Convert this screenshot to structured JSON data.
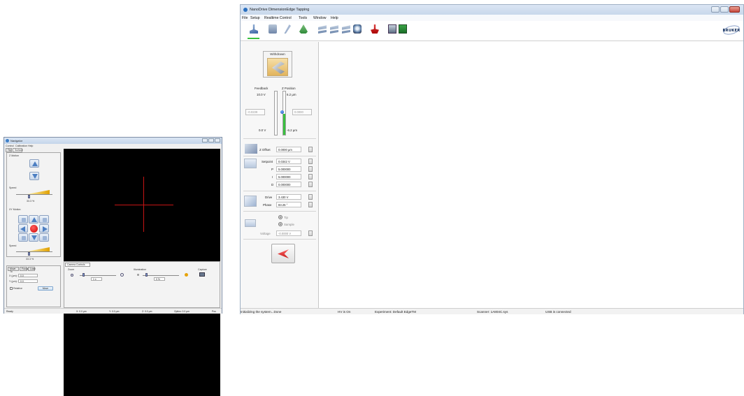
{
  "navigator": {
    "title": "Navigator",
    "menu": [
      "Control",
      "Calibration",
      "Help"
    ],
    "tabs": [
      "Tip",
      "Surface"
    ],
    "z_motion_label": "Z Motion",
    "speed_label": "Speed",
    "z_speed_value": "33.3 %",
    "xy_motion_label": "XY Motion",
    "xy_speed_value": "33.3 %",
    "bottom_tabs": [
      "Move To",
      "Focus",
      "Load"
    ],
    "x_label": "X (µm):",
    "x_value": "0.0",
    "y_label": "Y (µm):",
    "y_value": "0.0",
    "relative_label": "Relative",
    "move_label": "Move",
    "camera_controls_label": "Camera Controls",
    "zoom_label": "Zoom",
    "zoom_value": "1 x",
    "illumination_label": "Illumination",
    "illumination_value": "0 %",
    "capture_label": "Capture",
    "status": [
      "Ready",
      "X: 0.0 µm",
      "Y: 0.0 µm",
      "Z: 0.0 µm",
      "Optics: 0.0 µm",
      "Pos"
    ]
  },
  "nanodrive": {
    "title": "NanoDrive DimensionEdge Tapping",
    "menu": [
      "File",
      "Setup",
      "Realtime Control",
      "Tools",
      "Window",
      "Help"
    ],
    "logo_text": "BRUKER",
    "withdrawn_label": "Withdrawn",
    "feedback_label": "Feedback",
    "z_position_label": "Z Position",
    "feedback_max": "10.0 V",
    "z_pos_max": "6.2 µm",
    "feedback_readout": "-0.0239",
    "z_readout": "0.0000",
    "feedback_min": "0.0 V",
    "z_pos_min": "-6.2 µm",
    "z_offset_label": "Z Offset",
    "z_offset_value": "0.0000 µm",
    "setpoint_label": "Setpoint",
    "setpoint_value": "0.0342 V",
    "p_label": "P",
    "p_value": "5.000000",
    "i_label": "I",
    "i_value": "5.000000",
    "d_label": "D",
    "d_value": "0.000000",
    "drive_label": "Drive",
    "drive_value": "3.430 V",
    "phase_label": "Phase",
    "phase_value": "83.25 °",
    "tip_label": "Tip",
    "sample_label": "Sample",
    "voltage_label": "Voltage",
    "voltage_value": "-0.0000 V",
    "status": [
      "Initializing the system...Done",
      "HV is On",
      "Experiment: Default EdgeTM",
      "Scanner: 1A804C.sys",
      "USB is connected"
    ]
  },
  "colors": {
    "accent": "#3f80c8",
    "feedback_bar": "#39c03f",
    "crosshair": "#c61414"
  }
}
